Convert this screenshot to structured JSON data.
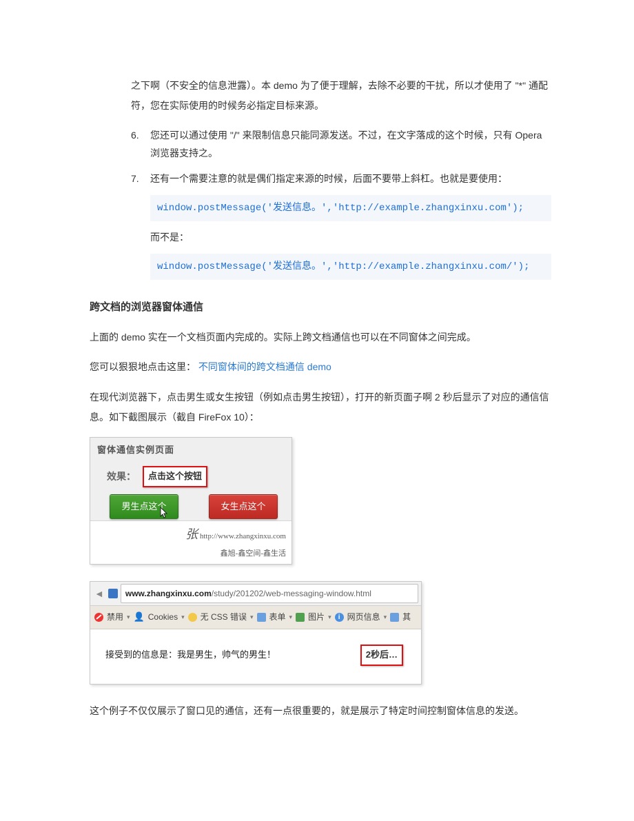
{
  "intro_continuation": "之下啊（不安全的信息泄露）。本 demo 为了便于理解，去除不必要的干扰，所以才使用了 \"*\" 通配符，您在实际使用的时候务必指定目标来源。",
  "list": {
    "item6": {
      "num": "6.",
      "text": "您还可以通过使用 \"/\" 来限制信息只能同源发送。不过，在文字落成的这个时候，只有 Opera 浏览器支持之。"
    },
    "item7": {
      "num": "7.",
      "text": "还有一个需要注意的就是偶们指定来源的时候，后面不要带上斜杠。也就是要使用：",
      "code_ok": "window.postMessage('发送信息。','http://example.zhangxinxu.com');",
      "rather_than": "而不是：",
      "code_bad": "window.postMessage('发送信息。','http://example.zhangxinxu.com/');"
    }
  },
  "section_heading": "跨文档的浏览器窗体通信",
  "para_above": "上面的 demo 实在一个文档页面内完成的。实际上跨文档通信也可以在不同窗体之间完成。",
  "para_click_prefix": "您可以狠狠地点击这里：",
  "para_click_link": "不同窗体间的跨文档通信 demo",
  "para_modern": "在现代浏览器下，点击男生或女生按钮（例如点击男生按钮），打开的新页面子啊 2 秒后显示了对应的通信信息。如下截图展示（截自 FireFox 10）：",
  "fig1": {
    "titlebar": "窗体通信实例页面",
    "label": "效果：",
    "callout": "点击这个按钮",
    "boy_btn": "男生点这个",
    "girl_btn": "女生点这个",
    "watermark_name": "张",
    "watermark_url": "http://www.zhangxinxu.com",
    "watermark_sub": "鑫旭-鑫空间-鑫生活"
  },
  "fig2": {
    "url_domain": "www.zhangxinxu.com",
    "url_path": "/study/201202/web-messaging-window.html",
    "toolbar": {
      "disable": "禁用",
      "cookies": "Cookies",
      "nocss": "无 CSS 错误",
      "forms": "表单",
      "images": "图片",
      "pageinfo": "网页信息",
      "more": "其"
    },
    "received_msg": "接受到的信息是：我是男生，帅气的男生！",
    "callout": "2秒后…"
  },
  "closing_para": "这个例子不仅仅展示了窗口见的通信，还有一点很重要的，就是展示了特定时间控制窗体信息的发送。"
}
